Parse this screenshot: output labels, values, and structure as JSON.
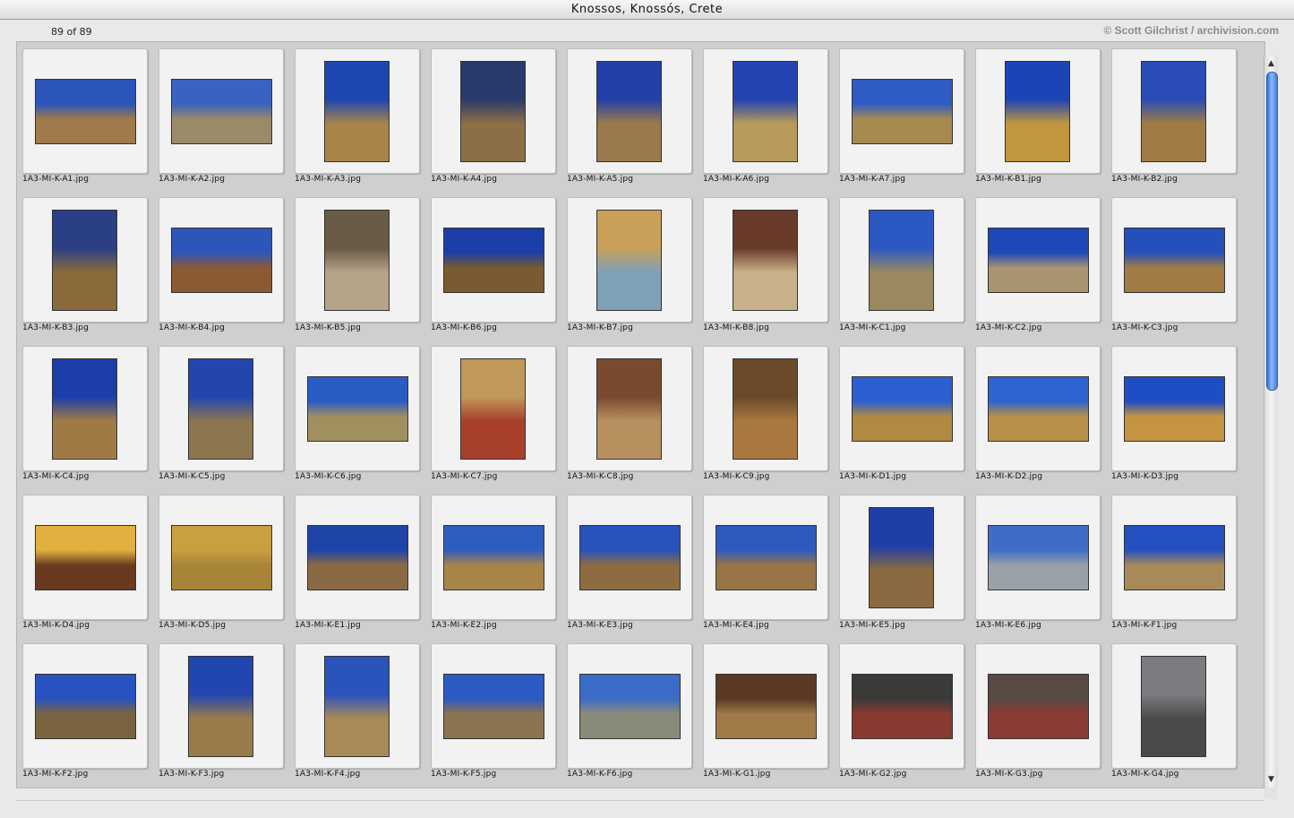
{
  "window": {
    "title": "Knossos, Knossós, Crete"
  },
  "header": {
    "count": "89 of 89",
    "credit": "© Scott Gilchrist / archivision.com"
  },
  "slides": [
    {
      "name": "1A3-MI-K-A1.jpg",
      "o": "land",
      "c1": "#2b55b8",
      "c2": "#a07a4a"
    },
    {
      "name": "1A3-MI-K-A2.jpg",
      "o": "land",
      "c1": "#3a62c0",
      "c2": "#9a8a6a"
    },
    {
      "name": "1A3-MI-K-A3.jpg",
      "o": "port",
      "c1": "#1e46b0",
      "c2": "#a88448"
    },
    {
      "name": "1A3-MI-K-A4.jpg",
      "o": "port",
      "c1": "#2a3a6a",
      "c2": "#8d6f45"
    },
    {
      "name": "1A3-MI-K-A5.jpg",
      "o": "port",
      "c1": "#2340a8",
      "c2": "#9a7a4c"
    },
    {
      "name": "1A3-MI-K-A6.jpg",
      "o": "port",
      "c1": "#2344b0",
      "c2": "#b89a5a"
    },
    {
      "name": "1A3-MI-K-A7.jpg",
      "o": "land",
      "c1": "#2f5cc4",
      "c2": "#a88a50"
    },
    {
      "name": "1A3-MI-K-B1.jpg",
      "o": "port",
      "c1": "#1d44b4",
      "c2": "#c0963e"
    },
    {
      "name": "1A3-MI-K-B2.jpg",
      "o": "port",
      "c1": "#2a4cb6",
      "c2": "#a07c44"
    },
    {
      "name": "1A3-MI-K-B3.jpg",
      "o": "port",
      "c1": "#2a3f86",
      "c2": "#8a6a3a"
    },
    {
      "name": "1A3-MI-K-B4.jpg",
      "o": "land",
      "c1": "#2e56b8",
      "c2": "#8a5a34"
    },
    {
      "name": "1A3-MI-K-B5.jpg",
      "o": "port",
      "c1": "#6a5a48",
      "c2": "#b4a48a"
    },
    {
      "name": "1A3-MI-K-B6.jpg",
      "o": "land",
      "c1": "#1c3ea8",
      "c2": "#7a5a30"
    },
    {
      "name": "1A3-MI-K-B7.jpg",
      "o": "port",
      "c1": "#c8a058",
      "c2": "#7ea0b8"
    },
    {
      "name": "1A3-MI-K-B8.jpg",
      "o": "port",
      "c1": "#6a3a2a",
      "c2": "#c8b088"
    },
    {
      "name": "1A3-MI-K-C1.jpg",
      "o": "port",
      "c1": "#2c58c4",
      "c2": "#9a8860"
    },
    {
      "name": "1A3-MI-K-C2.jpg",
      "o": "land",
      "c1": "#1e48b8",
      "c2": "#a89470"
    },
    {
      "name": "1A3-MI-K-C3.jpg",
      "o": "land",
      "c1": "#2450bc",
      "c2": "#a07c44"
    },
    {
      "name": "1A3-MI-K-C4.jpg",
      "o": "port",
      "c1": "#1c3eaa",
      "c2": "#a07a44"
    },
    {
      "name": "1A3-MI-K-C5.jpg",
      "o": "port",
      "c1": "#2246ae",
      "c2": "#8c7650"
    },
    {
      "name": "1A3-MI-K-C6.jpg",
      "o": "land",
      "c1": "#2a5cc4",
      "c2": "#a09060"
    },
    {
      "name": "1A3-MI-K-C7.jpg",
      "o": "port",
      "c1": "#c0985a",
      "c2": "#a8402c"
    },
    {
      "name": "1A3-MI-K-C8.jpg",
      "o": "port",
      "c1": "#7a4a30",
      "c2": "#b89060"
    },
    {
      "name": "1A3-MI-K-C9.jpg",
      "o": "port",
      "c1": "#6a4a2a",
      "c2": "#a87840"
    },
    {
      "name": "1A3-MI-K-D1.jpg",
      "o": "land",
      "c1": "#2c60d0",
      "c2": "#b08a40"
    },
    {
      "name": "1A3-MI-K-D2.jpg",
      "o": "land",
      "c1": "#2c64d0",
      "c2": "#b89048"
    },
    {
      "name": "1A3-MI-K-D3.jpg",
      "o": "land",
      "c1": "#1e4ec4",
      "c2": "#c49440"
    },
    {
      "name": "1A3-MI-K-D4.jpg",
      "o": "land",
      "c1": "#e0b040",
      "c2": "#6a3a20"
    },
    {
      "name": "1A3-MI-K-D5.jpg",
      "o": "land",
      "c1": "#c8a040",
      "c2": "#a88438"
    },
    {
      "name": "1A3-MI-K-E1.jpg",
      "o": "land",
      "c1": "#1e44a8",
      "c2": "#8a6a44"
    },
    {
      "name": "1A3-MI-K-E2.jpg",
      "o": "land",
      "c1": "#2e5cc0",
      "c2": "#a88448"
    },
    {
      "name": "1A3-MI-K-E3.jpg",
      "o": "land",
      "c1": "#2852bc",
      "c2": "#8c6c40"
    },
    {
      "name": "1A3-MI-K-E4.jpg",
      "o": "land",
      "c1": "#2e5ac0",
      "c2": "#9a7444"
    },
    {
      "name": "1A3-MI-K-E5.jpg",
      "o": "port",
      "c1": "#1e3ea8",
      "c2": "#8a6a40"
    },
    {
      "name": "1A3-MI-K-E6.jpg",
      "o": "land",
      "c1": "#3e6cc8",
      "c2": "#9aa0a8"
    },
    {
      "name": "1A3-MI-K-F1.jpg",
      "o": "land",
      "c1": "#2450c0",
      "c2": "#a88a5a"
    },
    {
      "name": "1A3-MI-K-F2.jpg",
      "o": "land",
      "c1": "#2852c0",
      "c2": "#7a6440"
    },
    {
      "name": "1A3-MI-K-F3.jpg",
      "o": "port",
      "c1": "#2246b0",
      "c2": "#9a7c4c"
    },
    {
      "name": "1A3-MI-K-F4.jpg",
      "o": "port",
      "c1": "#2a54bc",
      "c2": "#a88a58"
    },
    {
      "name": "1A3-MI-K-F5.jpg",
      "o": "land",
      "c1": "#2e5ac4",
      "c2": "#8a7450"
    },
    {
      "name": "1A3-MI-K-F6.jpg",
      "o": "land",
      "c1": "#3a6cc8",
      "c2": "#8a8a78"
    },
    {
      "name": "1A3-MI-K-G1.jpg",
      "o": "land",
      "c1": "#5a3a24",
      "c2": "#a07a48"
    },
    {
      "name": "1A3-MI-K-G2.jpg",
      "o": "land",
      "c1": "#3a3a38",
      "c2": "#8a3a30"
    },
    {
      "name": "1A3-MI-K-G3.jpg",
      "o": "land",
      "c1": "#5a4a44",
      "c2": "#8c3a34"
    },
    {
      "name": "1A3-MI-K-G4.jpg",
      "o": "port",
      "c1": "#7a7c80",
      "c2": "#4a4a48"
    }
  ]
}
